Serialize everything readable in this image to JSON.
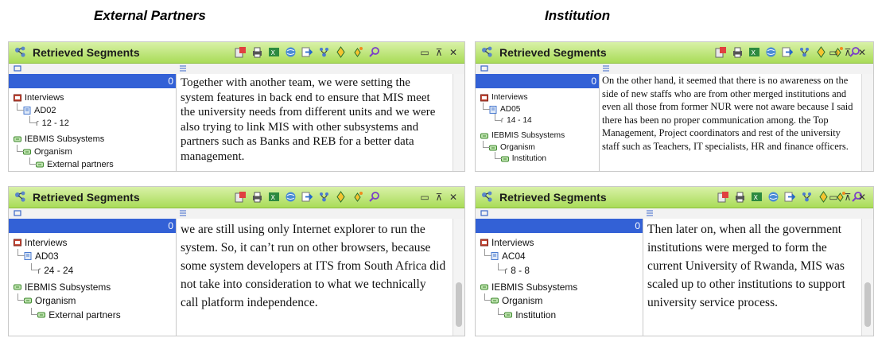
{
  "headings": {
    "left": "External Partners",
    "right": "Institution"
  },
  "panel_title": "Retrieved Segments",
  "count": "0",
  "tree_labels": {
    "interviews": "Interviews",
    "subsystems": "IEBMIS Subsystems",
    "organism": "Organism"
  },
  "panels": [
    {
      "doc": "AD02",
      "range": "12 - 12",
      "leaf": "External partners",
      "text": "Together with another team, we were setting the system features in back end to ensure that MIS meet the university needs from different units and we were also trying to link MIS with other subsystems and partners such as Banks and REB for a better data management."
    },
    {
      "doc": "AD05",
      "range": "14 - 14",
      "leaf": "Institution",
      "text": "On the other hand, it seemed that there is no awareness on the side of new staffs who are from other merged institutions and even all those from former NUR were not aware because I said there has been no proper communication among. the Top Management, Project coordinators and rest of the university staff such as Teachers, IT specialists, HR and finance officers."
    },
    {
      "doc": "AD03",
      "range": "24 - 24",
      "leaf": "External partners",
      "text": "we are still using only Internet explorer to run the system. So, it can’t run on other browsers, because some system developers at ITS from South Africa did not take into consideration to what we technically call platform independence."
    },
    {
      "doc": "AC04",
      "range": "8 - 8",
      "leaf": "Institution",
      "text": "Then later on, when all the government institutions were merged to form the current University of Rwanda, MIS was scaled up to other institutions to support university service process."
    }
  ],
  "toolbar_icons": [
    "export-icon",
    "print-icon",
    "excel-icon",
    "web-icon",
    "arrow-right-icon",
    "filter-icon",
    "node-icon",
    "node-star-icon",
    "search-icon"
  ],
  "colors": {
    "title_gradient_top": "#d9f1a8",
    "title_gradient_bottom": "#a9dc58",
    "selection": "#3361d6"
  }
}
